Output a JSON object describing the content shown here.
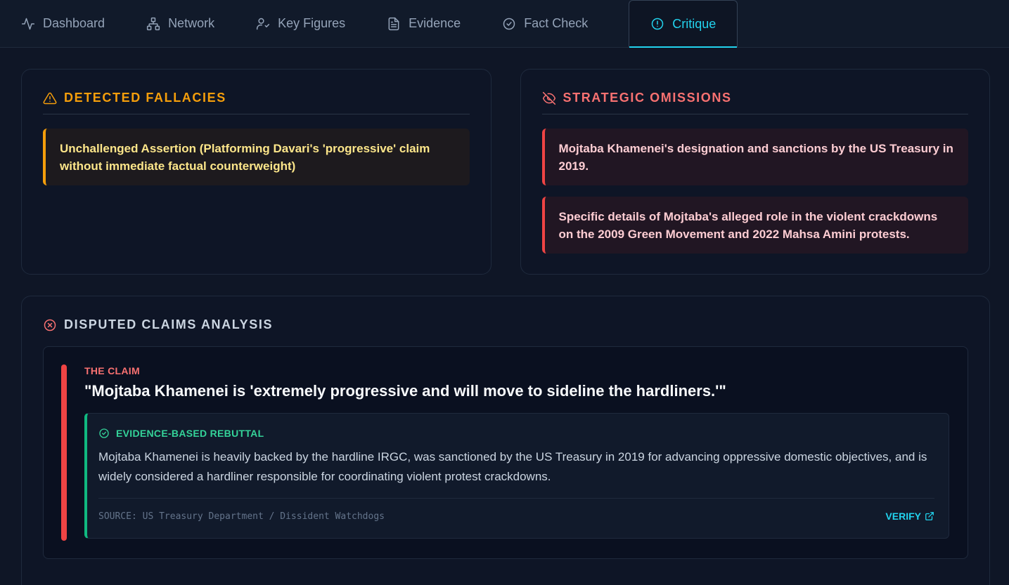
{
  "tabs": [
    {
      "label": "Dashboard",
      "icon": "activity-icon"
    },
    {
      "label": "Network",
      "icon": "network-icon"
    },
    {
      "label": "Key Figures",
      "icon": "user-check-icon"
    },
    {
      "label": "Evidence",
      "icon": "file-text-icon"
    },
    {
      "label": "Fact Check",
      "icon": "check-circle-icon"
    },
    {
      "label": "Critique",
      "icon": "alert-circle-icon",
      "active": true
    }
  ],
  "fallacies": {
    "title": "DETECTED FALLACIES",
    "items": [
      "Unchallenged Assertion (Platforming Davari's 'progressive' claim without immediate factual counterweight)"
    ]
  },
  "omissions": {
    "title": "STRATEGIC OMISSIONS",
    "items": [
      "Mojtaba Khamenei's designation and sanctions by the US Treasury in 2019.",
      "Specific details of Mojtaba's alleged role in the violent crackdowns on the 2009 Green Movement and 2022 Mahsa Amini protests."
    ]
  },
  "disputed": {
    "title": "DISPUTED CLAIMS ANALYSIS",
    "claim_label": "THE CLAIM",
    "claim_text": "\"Mojtaba Khamenei is 'extremely progressive and will move to sideline the hardliners.'\"",
    "rebuttal_label": "EVIDENCE-BASED REBUTTAL",
    "rebuttal_text": "Mojtaba Khamenei is heavily backed by the hardline IRGC, was sanctioned by the US Treasury in 2019 for advancing oppressive domestic objectives, and is widely considered a hardliner responsible for coordinating violent protest crackdowns.",
    "source": "SOURCE: US Treasury Department / Dissident Watchdogs",
    "verify_label": "VERIFY"
  },
  "colors": {
    "accent": "#22d3ee",
    "amber": "#f59e0b",
    "red": "#ef4444",
    "green": "#10b981"
  }
}
